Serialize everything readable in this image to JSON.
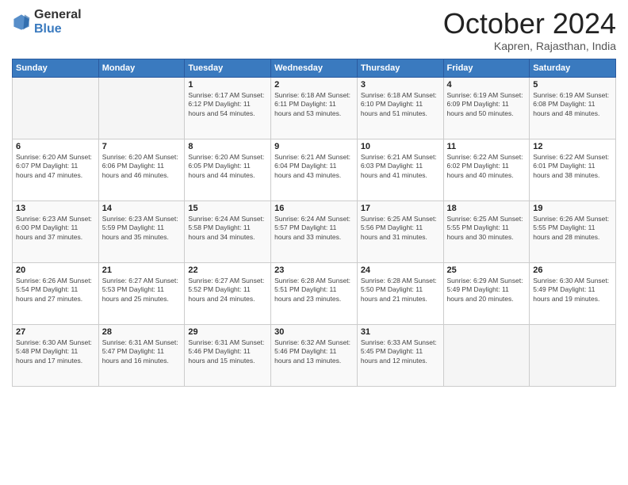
{
  "logo": {
    "general": "General",
    "blue": "Blue"
  },
  "header": {
    "month": "October 2024",
    "location": "Kapren, Rajasthan, India"
  },
  "days_of_week": [
    "Sunday",
    "Monday",
    "Tuesday",
    "Wednesday",
    "Thursday",
    "Friday",
    "Saturday"
  ],
  "weeks": [
    [
      {
        "day": "",
        "info": ""
      },
      {
        "day": "",
        "info": ""
      },
      {
        "day": "1",
        "info": "Sunrise: 6:17 AM\nSunset: 6:12 PM\nDaylight: 11 hours and 54 minutes."
      },
      {
        "day": "2",
        "info": "Sunrise: 6:18 AM\nSunset: 6:11 PM\nDaylight: 11 hours and 53 minutes."
      },
      {
        "day": "3",
        "info": "Sunrise: 6:18 AM\nSunset: 6:10 PM\nDaylight: 11 hours and 51 minutes."
      },
      {
        "day": "4",
        "info": "Sunrise: 6:19 AM\nSunset: 6:09 PM\nDaylight: 11 hours and 50 minutes."
      },
      {
        "day": "5",
        "info": "Sunrise: 6:19 AM\nSunset: 6:08 PM\nDaylight: 11 hours and 48 minutes."
      }
    ],
    [
      {
        "day": "6",
        "info": "Sunrise: 6:20 AM\nSunset: 6:07 PM\nDaylight: 11 hours and 47 minutes."
      },
      {
        "day": "7",
        "info": "Sunrise: 6:20 AM\nSunset: 6:06 PM\nDaylight: 11 hours and 46 minutes."
      },
      {
        "day": "8",
        "info": "Sunrise: 6:20 AM\nSunset: 6:05 PM\nDaylight: 11 hours and 44 minutes."
      },
      {
        "day": "9",
        "info": "Sunrise: 6:21 AM\nSunset: 6:04 PM\nDaylight: 11 hours and 43 minutes."
      },
      {
        "day": "10",
        "info": "Sunrise: 6:21 AM\nSunset: 6:03 PM\nDaylight: 11 hours and 41 minutes."
      },
      {
        "day": "11",
        "info": "Sunrise: 6:22 AM\nSunset: 6:02 PM\nDaylight: 11 hours and 40 minutes."
      },
      {
        "day": "12",
        "info": "Sunrise: 6:22 AM\nSunset: 6:01 PM\nDaylight: 11 hours and 38 minutes."
      }
    ],
    [
      {
        "day": "13",
        "info": "Sunrise: 6:23 AM\nSunset: 6:00 PM\nDaylight: 11 hours and 37 minutes."
      },
      {
        "day": "14",
        "info": "Sunrise: 6:23 AM\nSunset: 5:59 PM\nDaylight: 11 hours and 35 minutes."
      },
      {
        "day": "15",
        "info": "Sunrise: 6:24 AM\nSunset: 5:58 PM\nDaylight: 11 hours and 34 minutes."
      },
      {
        "day": "16",
        "info": "Sunrise: 6:24 AM\nSunset: 5:57 PM\nDaylight: 11 hours and 33 minutes."
      },
      {
        "day": "17",
        "info": "Sunrise: 6:25 AM\nSunset: 5:56 PM\nDaylight: 11 hours and 31 minutes."
      },
      {
        "day": "18",
        "info": "Sunrise: 6:25 AM\nSunset: 5:55 PM\nDaylight: 11 hours and 30 minutes."
      },
      {
        "day": "19",
        "info": "Sunrise: 6:26 AM\nSunset: 5:55 PM\nDaylight: 11 hours and 28 minutes."
      }
    ],
    [
      {
        "day": "20",
        "info": "Sunrise: 6:26 AM\nSunset: 5:54 PM\nDaylight: 11 hours and 27 minutes."
      },
      {
        "day": "21",
        "info": "Sunrise: 6:27 AM\nSunset: 5:53 PM\nDaylight: 11 hours and 25 minutes."
      },
      {
        "day": "22",
        "info": "Sunrise: 6:27 AM\nSunset: 5:52 PM\nDaylight: 11 hours and 24 minutes."
      },
      {
        "day": "23",
        "info": "Sunrise: 6:28 AM\nSunset: 5:51 PM\nDaylight: 11 hours and 23 minutes."
      },
      {
        "day": "24",
        "info": "Sunrise: 6:28 AM\nSunset: 5:50 PM\nDaylight: 11 hours and 21 minutes."
      },
      {
        "day": "25",
        "info": "Sunrise: 6:29 AM\nSunset: 5:49 PM\nDaylight: 11 hours and 20 minutes."
      },
      {
        "day": "26",
        "info": "Sunrise: 6:30 AM\nSunset: 5:49 PM\nDaylight: 11 hours and 19 minutes."
      }
    ],
    [
      {
        "day": "27",
        "info": "Sunrise: 6:30 AM\nSunset: 5:48 PM\nDaylight: 11 hours and 17 minutes."
      },
      {
        "day": "28",
        "info": "Sunrise: 6:31 AM\nSunset: 5:47 PM\nDaylight: 11 hours and 16 minutes."
      },
      {
        "day": "29",
        "info": "Sunrise: 6:31 AM\nSunset: 5:46 PM\nDaylight: 11 hours and 15 minutes."
      },
      {
        "day": "30",
        "info": "Sunrise: 6:32 AM\nSunset: 5:46 PM\nDaylight: 11 hours and 13 minutes."
      },
      {
        "day": "31",
        "info": "Sunrise: 6:33 AM\nSunset: 5:45 PM\nDaylight: 11 hours and 12 minutes."
      },
      {
        "day": "",
        "info": ""
      },
      {
        "day": "",
        "info": ""
      }
    ]
  ]
}
